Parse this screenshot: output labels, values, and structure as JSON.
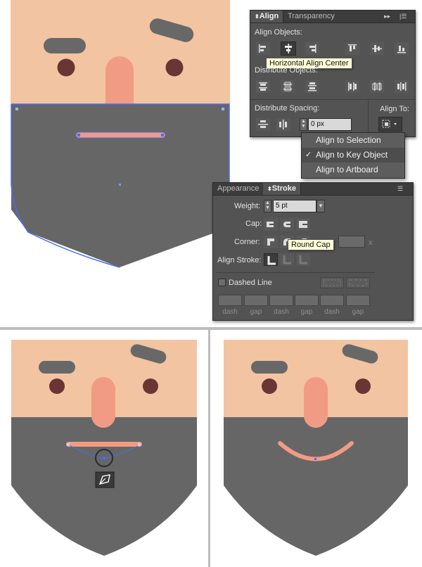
{
  "colors": {
    "skin": "#f3c4a1",
    "beard": "#666666",
    "nose": "#f29b84",
    "eye": "#6b3435",
    "brow": "#686868",
    "selection": "#4a6cf0",
    "panel_bg": "#535353"
  },
  "align_panel": {
    "tabs": [
      "Align",
      "Transparency"
    ],
    "align_objects_label": "Align Objects:",
    "distribute_objects_label": "Distribute Objects:",
    "distribute_spacing_label": "Distribute Spacing:",
    "align_to_label": "Align To:",
    "spacing_value": "0 px",
    "tooltip": "Horizontal Align Center",
    "menu_items": [
      "Align to Selection",
      "Align to Key Object",
      "Align to Artboard"
    ],
    "menu_checked": 1
  },
  "stroke_panel": {
    "tabs": [
      "Appearance",
      "Stroke"
    ],
    "weight_label": "Weight:",
    "weight_value": "5 pt",
    "cap_label": "Cap:",
    "corner_label": "Corner:",
    "limit_suffix": "x",
    "align_stroke_label": "Align Stroke:",
    "dashed_line_label": "Dashed Line",
    "tooltip": "Round Cap",
    "dash_labels": [
      "dash",
      "gap",
      "dash",
      "gap",
      "dash",
      "gap"
    ]
  },
  "icons": {
    "pen_tool": "pen-tool-icon",
    "anchor": "anchor-point-icon",
    "align_to": "align-to-key-object-icon"
  }
}
